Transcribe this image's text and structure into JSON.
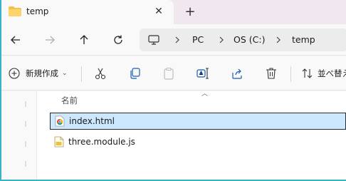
{
  "tab": {
    "title": "temp",
    "close_icon": "close-icon",
    "new_tab_icon": "plus-icon"
  },
  "nav": {
    "back_icon": "arrow-left-icon",
    "forward_icon": "arrow-right-icon",
    "up_icon": "arrow-up-icon",
    "refresh_icon": "refresh-icon"
  },
  "address": {
    "crumbs": [
      "PC",
      "OS (C:)",
      "temp"
    ],
    "device_icon": "monitor-icon"
  },
  "toolbar": {
    "new_label": "新規作成",
    "sort_label": "並べ替え",
    "items": [
      "cut-icon",
      "copy-icon",
      "paste-icon",
      "rename-icon",
      "share-icon",
      "delete-icon"
    ]
  },
  "list": {
    "column_name": "名前",
    "files": [
      {
        "name": "index.html",
        "icon": "chrome-html-icon",
        "selected": true
      },
      {
        "name": "three.module.js",
        "icon": "js-file-icon",
        "selected": false
      }
    ]
  },
  "colors": {
    "accent": "#3ab3c9",
    "selection": "#cce8ff",
    "folder": "#f5c04a"
  }
}
